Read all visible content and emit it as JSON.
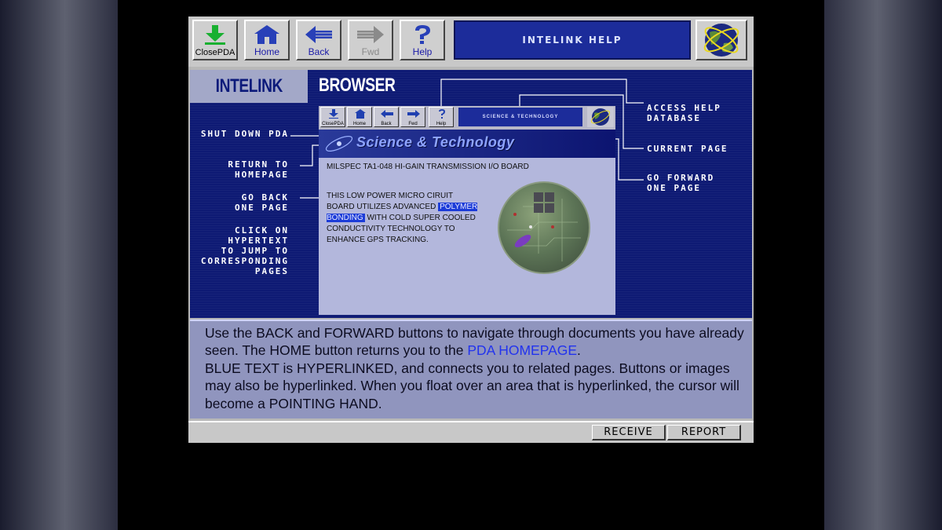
{
  "toolbar": {
    "buttons": [
      {
        "label": "ClosePDA",
        "icon": "download-arrow-icon",
        "enabled": true
      },
      {
        "label": "Home",
        "icon": "home-icon",
        "enabled": true
      },
      {
        "label": "Back",
        "icon": "back-arrow-icon",
        "enabled": true
      },
      {
        "label": "Fwd",
        "icon": "forward-arrow-icon",
        "enabled": false
      },
      {
        "label": "Help",
        "icon": "question-mark-icon",
        "enabled": true
      }
    ],
    "banner_title": "INTELINK HELP",
    "globe_icon": "globe-icon"
  },
  "main": {
    "tab_title": "INTELINK",
    "section_title": "BROWSER",
    "callouts_left": {
      "shut_down": "SHUT DOWN PDA",
      "return_home": "RETURN TO\nHOMEPAGE",
      "go_back": "GO BACK\nONE PAGE",
      "hypertext": "CLICK ON\nHYPERTEXT\nTO JUMP TO\nCORRESPONDING\nPAGES"
    },
    "callouts_right": {
      "help_db": "ACCESS HELP\nDATABASE",
      "current_page": "CURRENT PAGE",
      "go_forward": "GO FORWARD\nONE PAGE"
    },
    "mini_browser": {
      "buttons": [
        "ClosePDA",
        "Home",
        "Back",
        "Fwd",
        "Help"
      ],
      "banner": "SCIENCE & TECHNOLOGY",
      "header_title": "Science & Technology",
      "board_title": "MILSPEC TA1-048 HI-GAIN TRANSMISSION I/O BOARD",
      "desc_before": "THIS LOW POWER MICRO CIRUIT BOARD UTILIZES ADVANCED ",
      "desc_link": "POLYMER BONDING",
      "desc_after": " WITH COLD SUPER COOLED CONDUCTIVITY TECHNOLOGY TO ENHANCE GPS TRACKING."
    }
  },
  "instructions": {
    "part1": "Use the BACK and FORWARD buttons to navigate through documents you have already seen. The HOME button returns you to the ",
    "link": "PDA HOMEPAGE",
    "part2": ".",
    "part3": "BLUE TEXT is HYPERLINKED, and connects you to related pages. Buttons or images may also be hyperlinked. When you float over an area that is hyperlinked, the cursor will become a POINTING HAND."
  },
  "statusbar": {
    "receive": "RECEIVE",
    "report": "REPORT"
  },
  "colors": {
    "navy": "#0e1a74",
    "banner_blue": "#1c2c9a",
    "link_blue": "#2233ee",
    "instructions_bg": "#9095be"
  }
}
